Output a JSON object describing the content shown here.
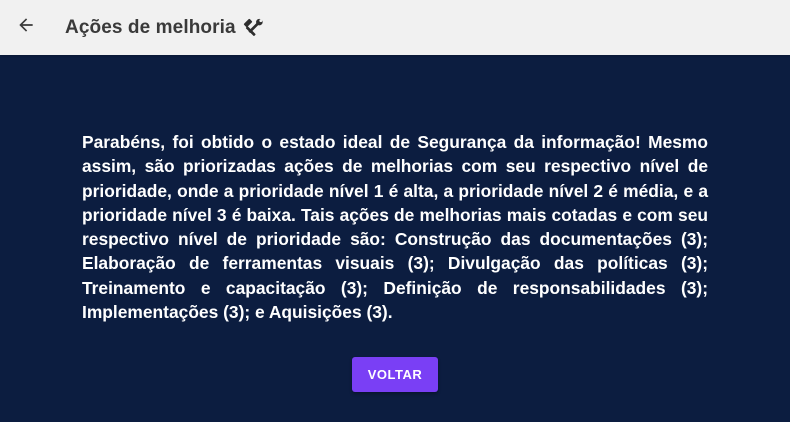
{
  "header": {
    "back_icon": "arrow-left-icon",
    "title": "Ações de melhoria",
    "title_icon": "hammer-wrench-icon"
  },
  "main": {
    "message": "Parabéns, foi obtido o estado ideal de Segurança da informação! Mesmo assim, são priorizadas ações de melhorias com seu respectivo nível de prioridade, onde a prioridade nível 1 é alta, a prioridade nível 2 é média, e a prioridade nível 3 é baixa. Tais ações de melhorias mais cotadas e com seu respectivo nível de prioridade são: Construção das documentações (3); Elaboração de ferramentas visuais (3); Divulgação das políticas (3); Treinamento e capacitação (3); Definição de responsabilidades (3); Implementações (3); e Aquisições (3).",
    "back_button_label": "VOLTAR"
  },
  "colors": {
    "header_bg": "#f1f1f1",
    "main_bg": "#0c1d40",
    "button_bg": "#7a3ff5",
    "text_light": "#ffffff"
  }
}
